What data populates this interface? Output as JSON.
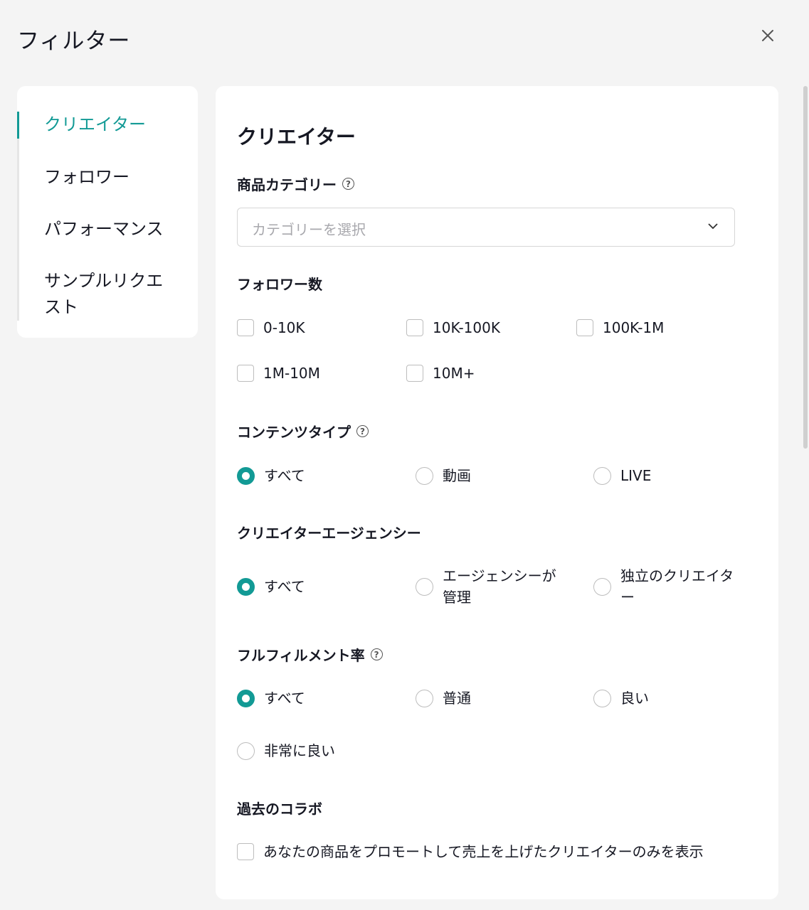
{
  "header": {
    "title": "フィルター",
    "close_icon": "close-icon"
  },
  "sidebar": {
    "items": [
      {
        "label": "クリエイター",
        "active": true
      },
      {
        "label": "フォロワー",
        "active": false
      },
      {
        "label": "パフォーマンス",
        "active": false
      },
      {
        "label": "サンプルリクエスト",
        "active": false
      }
    ]
  },
  "panel": {
    "title": "クリエイター",
    "category": {
      "label": "商品カテゴリー",
      "placeholder": "カテゴリーを選択"
    },
    "followers": {
      "label": "フォロワー数",
      "options": [
        "0-10K",
        "10K-100K",
        "100K-1M",
        "1M-10M",
        "10M+"
      ]
    },
    "content_type": {
      "label": "コンテンツタイプ",
      "options": [
        "すべて",
        "動画",
        "LIVE"
      ],
      "selected": "すべて"
    },
    "agency": {
      "label": "クリエイターエージェンシー",
      "options": [
        "すべて",
        "エージェンシーが管理",
        "独立のクリエイター"
      ],
      "selected": "すべて"
    },
    "fulfillment": {
      "label": "フルフィルメント率",
      "options": [
        "すべて",
        "普通",
        "良い",
        "非常に良い"
      ],
      "selected": "すべて"
    },
    "past_collab": {
      "label": "過去のコラボ",
      "option": "あなたの商品をプロモートして売上を上げたクリエイターのみを表示"
    }
  },
  "colors": {
    "accent": "#129a95",
    "background": "#f4f4f4",
    "card": "#ffffff"
  }
}
